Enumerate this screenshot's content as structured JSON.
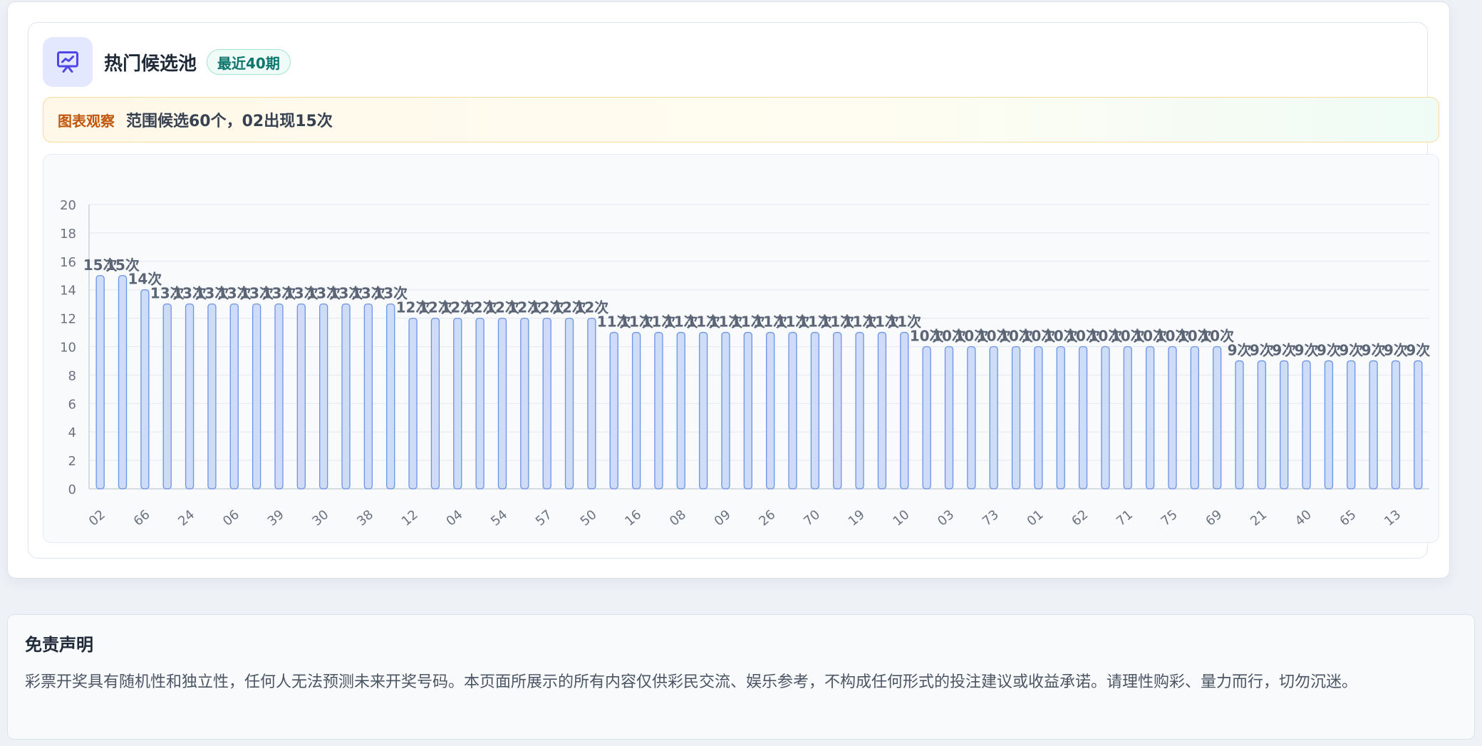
{
  "panel": {
    "title": "热门候选池",
    "badge": "最近40期",
    "icon": "presentation-chart-icon",
    "accent": "#4f46e5"
  },
  "observation": {
    "label": "图表观察",
    "text": "范围候选60个，02出现15次"
  },
  "chart_data": {
    "type": "bar",
    "value_suffix": "次",
    "ylim": [
      0,
      20
    ],
    "yticks": [
      0,
      2,
      4,
      6,
      8,
      10,
      12,
      14,
      16,
      18,
      20
    ],
    "grid": true,
    "bar_fill": "#cfdcf7",
    "bar_stroke": "#6b93e6",
    "categories": [
      "02",
      "66",
      "24",
      "06",
      "39",
      "30",
      "38",
      "12",
      "04",
      "54",
      "57",
      "50",
      "16",
      "08",
      "09",
      "26",
      "70",
      "19",
      "10",
      "03",
      "73",
      "01",
      "62",
      "71",
      "75",
      "69",
      "21",
      "40",
      "65",
      "13"
    ],
    "visible_tick_labels": [
      "02",
      "66",
      "24",
      "06",
      "39",
      "30",
      "38",
      "12",
      "04",
      "54",
      "57",
      "50",
      "16",
      "08",
      "09",
      "26",
      "70",
      "19",
      "10",
      "03",
      "73",
      "01",
      "62",
      "71",
      "75",
      "69",
      "21",
      "40",
      "65",
      "13"
    ],
    "values": [
      15,
      15,
      14,
      13,
      13,
      13,
      13,
      13,
      13,
      13,
      13,
      13,
      13,
      13,
      12,
      12,
      12,
      12,
      12,
      12,
      12,
      12,
      12,
      11,
      11,
      11,
      11,
      11,
      11,
      11,
      11,
      11,
      11,
      11,
      11,
      11,
      11,
      10,
      10,
      10,
      10,
      10,
      10,
      10,
      10,
      10,
      10,
      10,
      10,
      10,
      10,
      9,
      9,
      9,
      9,
      9,
      9,
      9,
      9,
      9
    ]
  },
  "disclaimer": {
    "title": "免责声明",
    "text": "彩票开奖具有随机性和独立性，任何人无法预测未来开奖号码。本页面所展示的所有内容仅供彩民交流、娱乐参考，不构成任何形式的投注建议或收益承诺。请理性购彩、量力而行，切勿沉迷。"
  }
}
